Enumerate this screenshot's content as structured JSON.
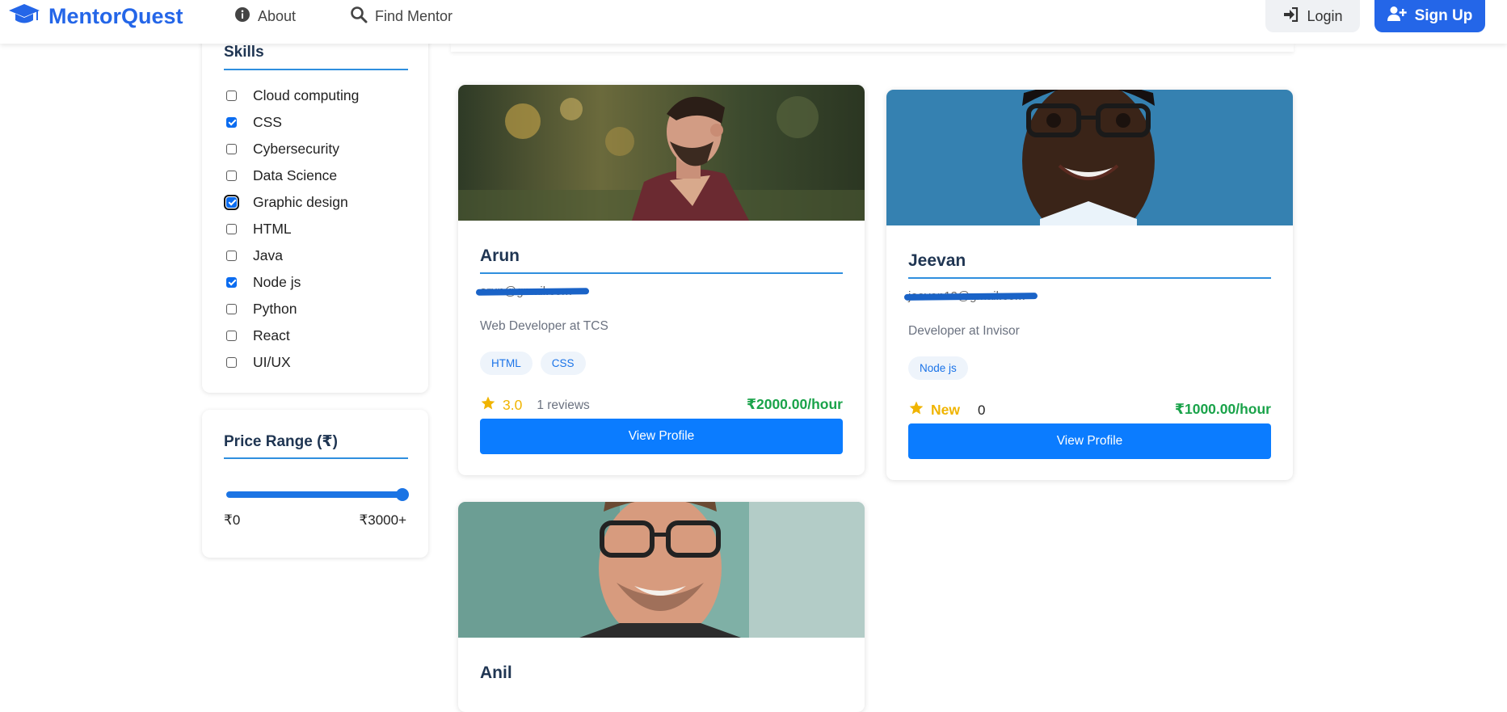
{
  "navbar": {
    "brand": "MentorQuest",
    "about_label": "About",
    "find_label": "Find Mentor",
    "login_label": "Login",
    "signup_label": "Sign Up"
  },
  "filters": {
    "skills_title": "Skills",
    "skills": [
      {
        "label": "Cloud computing",
        "checked": false
      },
      {
        "label": "CSS",
        "checked": true
      },
      {
        "label": "Cybersecurity",
        "checked": false
      },
      {
        "label": "Data Science",
        "checked": false
      },
      {
        "label": "Graphic design",
        "checked": true
      },
      {
        "label": "HTML",
        "checked": false
      },
      {
        "label": "Java",
        "checked": false
      },
      {
        "label": "Node js",
        "checked": true
      },
      {
        "label": "Python",
        "checked": false
      },
      {
        "label": "React",
        "checked": false
      },
      {
        "label": "UI/UX",
        "checked": false
      }
    ],
    "price_title": "Price Range (₹)",
    "price_min_label": "₹0",
    "price_max_label": "₹3000+",
    "price_slider_value_fraction": 1.0
  },
  "mentors": [
    {
      "name": "Arun",
      "email": "arun@gmail.com",
      "role": "Web Developer at TCS",
      "tags": [
        "HTML",
        "CSS"
      ],
      "rating": "3.0",
      "reviews": "1 reviews",
      "rate": "₹2000.00/hour",
      "button": "View Profile"
    },
    {
      "name": "Jeevan",
      "email": "jeevan12@gmail.com",
      "role": "Developer at Invisor",
      "tags": [
        "Node js"
      ],
      "rating": "New",
      "reviews": "0",
      "rate": "₹1000.00/hour",
      "button": "View Profile"
    },
    {
      "name": "Anil"
    }
  ],
  "colors": {
    "brand": "#2466e8",
    "primary_button": "#0b7cff",
    "price_green": "#1aa34a",
    "star": "#f0b400"
  }
}
